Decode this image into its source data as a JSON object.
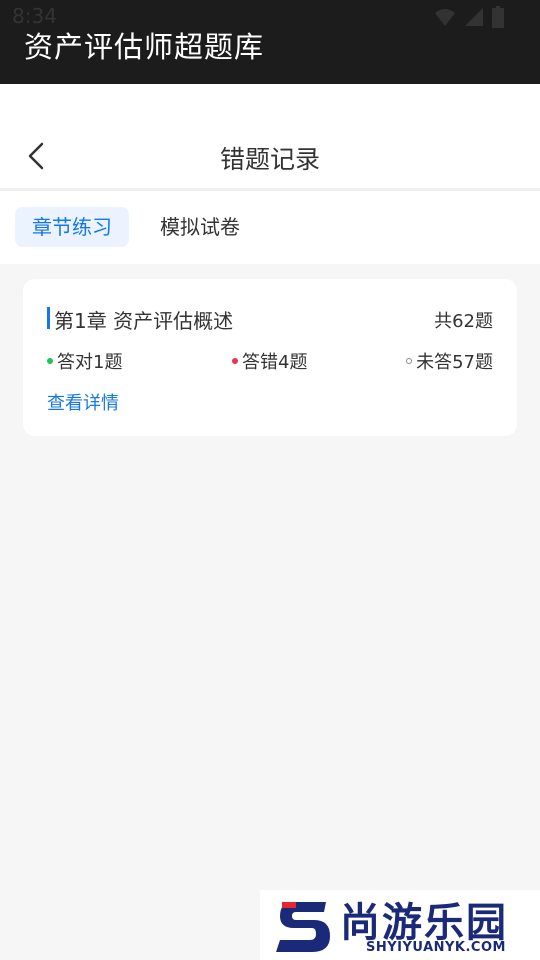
{
  "status_bar": {
    "time": "8:34",
    "icons": [
      "wifi-icon",
      "signal-icon",
      "battery-icon"
    ]
  },
  "app": {
    "title": "资产评估师超题库"
  },
  "header": {
    "title": "错题记录",
    "back_icon": "chevron-left-icon"
  },
  "tabs": [
    {
      "label": "章节练习",
      "active": true
    },
    {
      "label": "模拟试卷",
      "active": false
    }
  ],
  "chapter_card": {
    "title": "第1章 资产评估概述",
    "total": "共62题",
    "correct": "答对1题",
    "wrong": "答错4题",
    "unanswered": "未答57题",
    "details_link": "查看详情"
  },
  "watermark": {
    "name": "尚游乐园",
    "url": "SHYIYUANYK.COM"
  },
  "colors": {
    "accent": "#1677e8",
    "correct": "#1ec35a",
    "wrong": "#f0314b",
    "topbar": "#1c1c1c",
    "brand": "#1a2a78"
  }
}
